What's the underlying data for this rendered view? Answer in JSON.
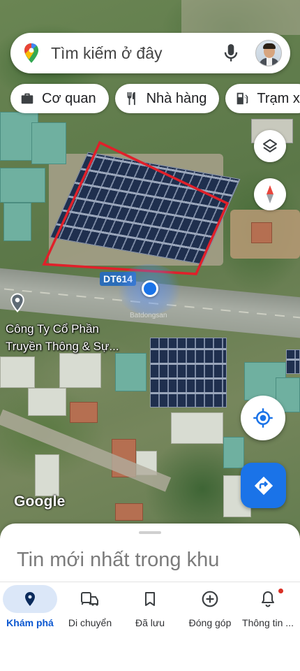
{
  "search": {
    "placeholder": "Tìm kiếm ở đây",
    "icons": [
      "maps-pin-icon",
      "mic-icon",
      "avatar"
    ]
  },
  "chips": [
    {
      "label": "Cơ quan",
      "icon": "briefcase-icon"
    },
    {
      "label": "Nhà hàng",
      "icon": "restaurant-icon"
    },
    {
      "label": "Trạm x",
      "icon": "gas-station-icon"
    }
  ],
  "map": {
    "road_label": "DT614",
    "poi": {
      "line1": "Công Ty Cổ Phần",
      "line2": "Truyền Thông & Sự...",
      "icon": "place-pin-icon"
    },
    "watermark": "Batdongsan",
    "attribution": "Google",
    "boundary_color": "#e0202a",
    "location_dot_color": "#1a73e8"
  },
  "map_buttons": [
    "layers-icon",
    "compass-icon",
    "my-location-icon",
    "directions-icon"
  ],
  "sheet": {
    "title": "Tin mới nhất trong khu"
  },
  "nav": {
    "items": [
      {
        "label": "Khám phá",
        "icon": "explore-pin-icon",
        "active": true
      },
      {
        "label": "Di chuyển",
        "icon": "commute-icon",
        "active": false
      },
      {
        "label": "Đã lưu",
        "icon": "bookmark-icon",
        "active": false
      },
      {
        "label": "Đóng góp",
        "icon": "add-circle-icon",
        "active": false
      },
      {
        "label": "Thông tin ...",
        "icon": "bell-icon",
        "active": false,
        "badge": true
      }
    ]
  },
  "colors": {
    "accent": "#1a73e8",
    "active_nav_bg": "#dbe7f8",
    "active_nav_text": "#0b57d0"
  }
}
